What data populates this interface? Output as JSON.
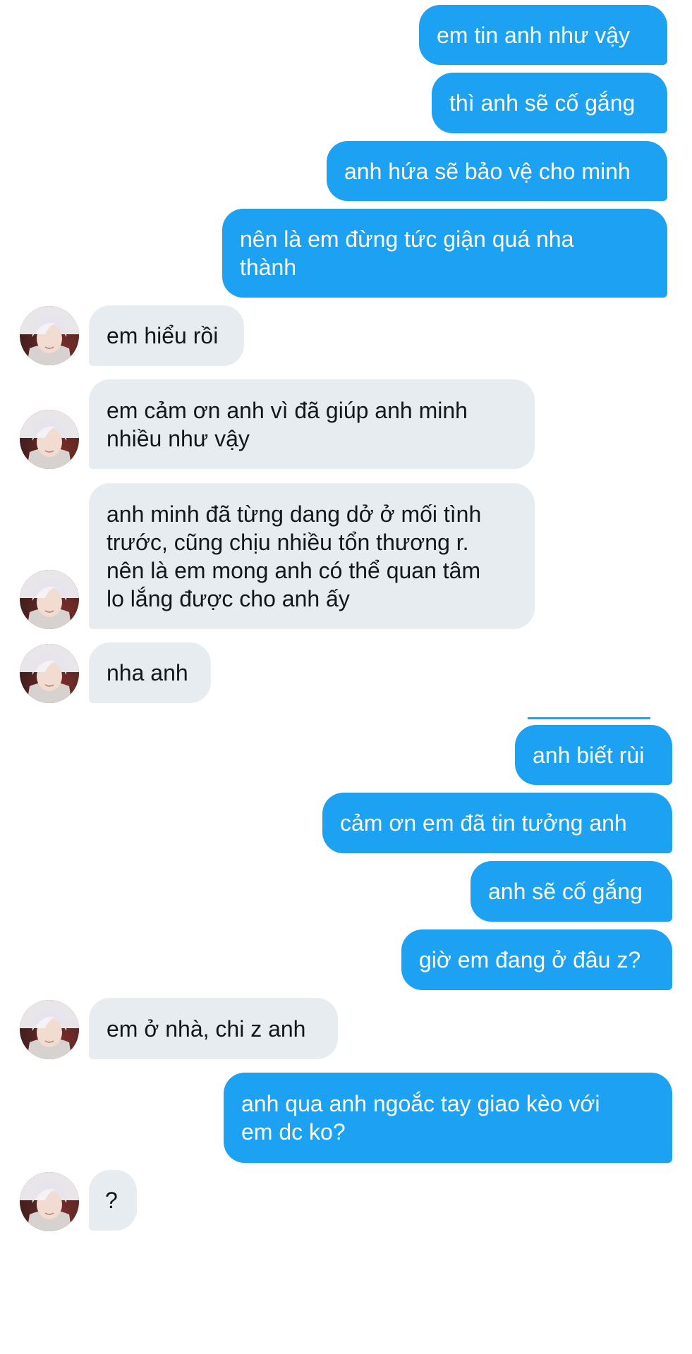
{
  "messages": [
    {
      "side": "out",
      "text": "em tin anh như vậy"
    },
    {
      "side": "out",
      "text": "thì anh sẽ cố gắng"
    },
    {
      "side": "out",
      "text": "anh hứa sẽ bảo vệ cho minh"
    },
    {
      "side": "out",
      "text": "nên là em đừng tức giận quá nha\nthành"
    },
    {
      "side": "in",
      "text": "em hiểu rồi"
    },
    {
      "side": "in",
      "text": "em cảm ơn anh vì đã giúp anh minh\nnhiều như vậy"
    },
    {
      "side": "in",
      "text": "anh minh đã từng dang dở ở mối tình\ntrước, cũng chịu nhiều tổn thương r.\nnên là em mong anh có thể quan tâm\nlo lắng được cho anh ấy"
    },
    {
      "side": "in",
      "text": "nha anh"
    },
    {
      "side": "out",
      "text": "anh biết rùi"
    },
    {
      "side": "out",
      "text": "cảm ơn em đã tin tưởng anh"
    },
    {
      "side": "out",
      "text": "anh sẽ cố gắng"
    },
    {
      "side": "out",
      "text": "giờ em đang ở đâu z?"
    },
    {
      "side": "in",
      "text": "em ở nhà, chi z anh"
    },
    {
      "side": "out",
      "text": "anh qua anh ngoắc tay giao kèo với\nem dc ko?"
    },
    {
      "side": "in",
      "text": "?"
    }
  ],
  "colors": {
    "outgoing_bubble": "#1da1f2",
    "incoming_bubble": "#e6ecf0",
    "outgoing_text": "#ffffff",
    "incoming_text": "#14171a"
  },
  "icons": {
    "avatar": "contact-avatar"
  }
}
